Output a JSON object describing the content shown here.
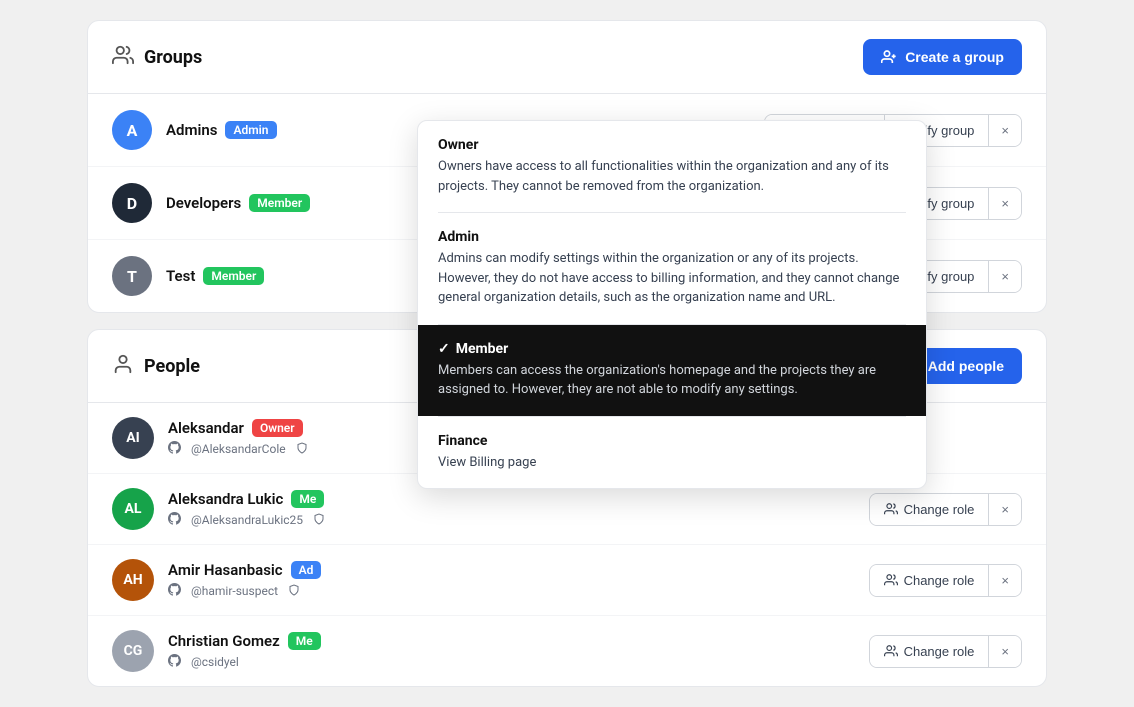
{
  "groups_section": {
    "title": "Groups",
    "create_button": "Create a group",
    "groups": [
      {
        "initial": "A",
        "name": "Admins",
        "badge": "Admin",
        "badge_type": "admin",
        "av_color": "av-blue"
      },
      {
        "initial": "D",
        "name": "Developers",
        "badge": "Member",
        "badge_type": "member",
        "av_color": "av-dark"
      },
      {
        "initial": "T",
        "name": "Test",
        "badge": "Member",
        "badge_type": "member",
        "av_color": "av-gray"
      }
    ],
    "change_role_label": "Change role",
    "modify_group_label": "Modify group"
  },
  "people_section": {
    "title": "People",
    "add_people_button": "Add people",
    "people": [
      {
        "name": "Aleksandar",
        "badge": "Owner",
        "badge_type": "owner",
        "username": "@AleksandarCole",
        "av_initials": "AI",
        "av_color": "p-av-aleksandar"
      },
      {
        "name": "Aleksandra Lukic",
        "badge": "Me",
        "badge_type": "member",
        "username": "@AleksandraLukic25",
        "av_initials": "AL",
        "av_color": "p-av-aleksandra"
      },
      {
        "name": "Amir Hasanbasic",
        "badge": "Ad",
        "badge_type": "amir",
        "username": "@hamir-suspect",
        "av_initials": "AH",
        "av_color": "p-av-amir"
      },
      {
        "name": "Christian Gomez",
        "badge": "Me",
        "badge_type": "christian",
        "username": "@csidyel",
        "av_initials": "CG",
        "av_color": "p-av-christian"
      }
    ],
    "change_role_label": "Change role"
  },
  "dropdown": {
    "items": [
      {
        "title": "Owner",
        "desc": "Owners have access to all functionalities within the organization and any of its projects. They cannot be removed from the organization.",
        "active": false,
        "dark": false
      },
      {
        "title": "Admin",
        "desc": "Admins can modify settings within the organization or any of its projects. However, they do not have access to billing information, and they cannot change general organization details, such as the organization name and URL.",
        "active": false,
        "dark": false
      },
      {
        "title": "Member",
        "desc": "Members can access the organization's homepage and the projects they are assigned to. However, they are not able to modify any settings.",
        "active": true,
        "dark": true
      },
      {
        "title": "Finance",
        "desc": "View Billing page",
        "active": false,
        "dark": false
      }
    ]
  },
  "icons": {
    "people": "👥",
    "add_person": "👤+",
    "change_role": "👥",
    "close": "×",
    "check": "✓",
    "github": "⊙",
    "shield": "🛡",
    "robot": "🤖",
    "leaf": "🌿",
    "person_dark": "👤"
  }
}
